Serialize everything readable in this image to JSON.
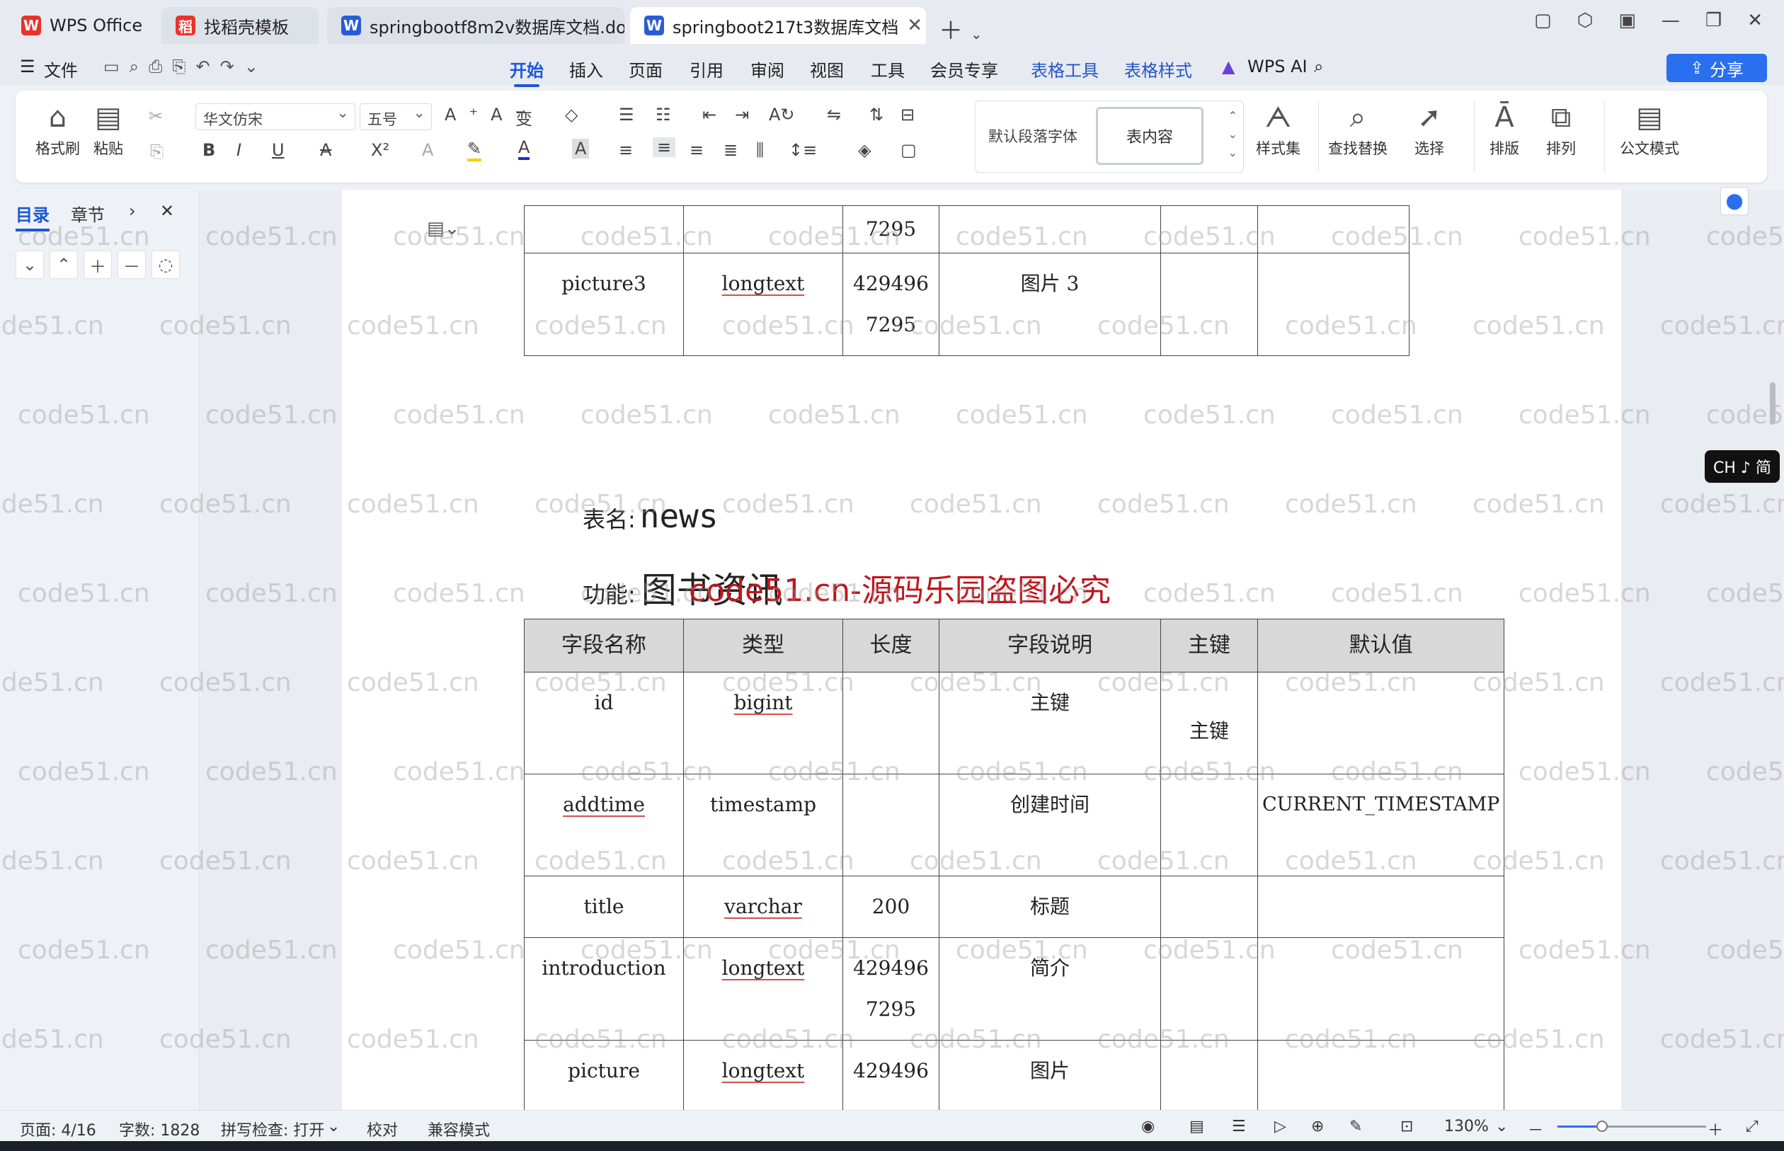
{
  "tabs": [
    {
      "label": "WPS Office",
      "color": "#e8332a",
      "glyph": "W"
    },
    {
      "label": "找稻壳模板",
      "color": "#e8332a",
      "glyph": "稻"
    },
    {
      "label": "springbootf8m2v数据库文档.doc",
      "color": "#2a5bd7",
      "glyph": "W"
    },
    {
      "label": "springboot217t3数据库文档",
      "color": "#2a5bd7",
      "glyph": "W"
    }
  ],
  "menu": {
    "file": "文件",
    "items": [
      "开始",
      "插入",
      "页面",
      "引用",
      "审阅",
      "视图",
      "工具",
      "会员专享",
      "表格工具",
      "表格样式"
    ],
    "wps_ai": "WPS AI",
    "share": "分享"
  },
  "ribbon": {
    "format_painter": "格式刷",
    "paste": "粘贴",
    "font_name": "华文仿宋",
    "font_size": "五号",
    "style_default": "默认段落字体",
    "style_current": "表内容",
    "style_set": "样式集",
    "find_replace": "查找替换",
    "select": "选择",
    "layout": "排版",
    "arrange": "排列",
    "official_mode": "公文模式"
  },
  "nav": {
    "tab_toc": "目录",
    "tab_chapter": "章节"
  },
  "document": {
    "prev_table_rows": [
      [
        "",
        "",
        "7295",
        "",
        "",
        ""
      ],
      [
        "picture3",
        "longtext",
        "429496 7295",
        "图片 3",
        "",
        ""
      ]
    ],
    "table_name_label": "表名:",
    "table_name": "news",
    "function_label": "功能:",
    "function_value": "图书资讯",
    "watermark_notice": "code51.cn-源码乐园盗图必究",
    "headers": [
      "字段名称",
      "类型",
      "长度",
      "字段说明",
      "主键",
      "默认值"
    ],
    "rows": [
      [
        "id",
        "bigint",
        "",
        "主键",
        "主键",
        ""
      ],
      [
        "addtime",
        "timestamp",
        "",
        "创建时间",
        "",
        "CURRENT_TIMESTAMP"
      ],
      [
        "title",
        "varchar",
        "200",
        "标题",
        "",
        ""
      ],
      [
        "introduction",
        "longtext",
        "429496 7295",
        "简介",
        "",
        ""
      ],
      [
        "picture",
        "longtext",
        "429496",
        "图片",
        "",
        ""
      ]
    ],
    "watermark": "code51.cn"
  },
  "ime": "CH ♪ 简",
  "status": {
    "page": "页面: 4/16",
    "words": "字数: 1828",
    "spell": "拼写检查: 打开",
    "proof": "校对",
    "compat": "兼容模式",
    "zoom": "130%",
    "zoom_level": 0.3
  }
}
